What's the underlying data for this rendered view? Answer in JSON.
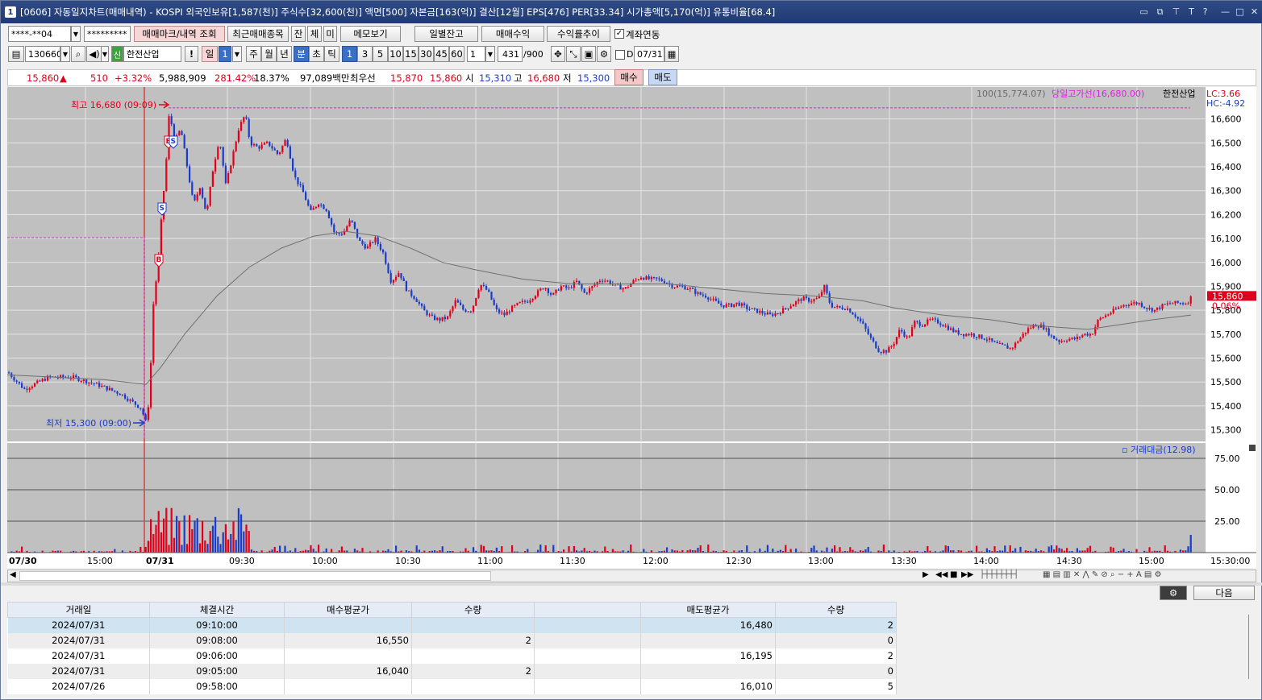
{
  "titlebar": {
    "num": "1",
    "text": "[0606] 자동일지차트(매매내역) - KOSPI 외국인보유[1,587(천)] 주식수[32,600(천)] 액면[500] 자본금[163(억)] 결산[12월] EPS[476] PER[33.34] 시가총액[5,170(억)] 유통비율[68.4]",
    "icons": [
      "window-layout-icon",
      "window-copy-icon",
      "pin-icon",
      "font-icon",
      "help-icon",
      "minimize-icon",
      "maximize-icon",
      "close-icon"
    ],
    "glyphs": [
      "▭",
      "⧉",
      "⊤",
      "T",
      "?",
      "—",
      "□",
      "✕"
    ]
  },
  "toolbar1": {
    "account": "****-**04",
    "password": "*********",
    "buttons": [
      "매매마크/내역 조회",
      "최근매매종목",
      "잔",
      "체",
      "미",
      "메모보기",
      "일별잔고",
      "매매수익",
      "수익률추이"
    ],
    "link_label": "계좌연동",
    "link_checked": true
  },
  "toolbar2": {
    "code": "130660",
    "credit": "신",
    "name": "한전산업",
    "warn": "!",
    "period_sel": "일",
    "period_num": "1",
    "periods": [
      "주",
      "월",
      "년"
    ],
    "intraday": [
      "분",
      "초",
      "틱"
    ],
    "intervals": [
      "1",
      "3",
      "5",
      "10",
      "15",
      "30",
      "45",
      "60"
    ],
    "step": "1",
    "count": "431",
    "max": "/900",
    "date": "07/31",
    "d_label": "D"
  },
  "quote": {
    "price": "15,860",
    "arrow": "▲",
    "change": "510",
    "pct": "+3.32%",
    "volume": "5,988,909",
    "vol_ratio": "281.42%",
    "turnover": "18.37%",
    "amount": "97,089백만",
    "best_label": "최우선",
    "ask": "15,870",
    "bid": "15,860",
    "open_label": "시",
    "open": "15,310",
    "high_label": "고",
    "high": "16,680",
    "low_label": "저",
    "low": "15,300",
    "buy": "매수",
    "sell": "매도"
  },
  "chart_data": {
    "type": "candlestick",
    "title": "",
    "y_ticks": [
      16600,
      16500,
      16400,
      16300,
      16200,
      16100,
      16000,
      15900,
      15800,
      15700,
      15600,
      15500,
      15400,
      15300
    ],
    "ylim": [
      15265,
      16700
    ],
    "x_labels": [
      "07/30",
      "15:00",
      "07/31",
      "09:30",
      "10:00",
      "10:30",
      "11:00",
      "11:30",
      "12:00",
      "12:30",
      "13:00",
      "13:30",
      "14:00",
      "14:30",
      "15:00",
      "15:30:00"
    ],
    "annotations": {
      "high": "최고 16,680 (09:09)",
      "low": "최저 15,300 (09:00)"
    },
    "legend": {
      "ma": "100(15,774.07)",
      "high_line": "당일고가선(16,680.00)",
      "series": "한전산업"
    },
    "prev_day_high": 16100,
    "today_high": 16680,
    "current": "15,860",
    "current_pct": "0.06%",
    "lc": "LC:3.66",
    "hc": "HC:-4.92",
    "marks": [
      "B",
      "S",
      "B",
      "S"
    ],
    "volume_panel": {
      "label": "거래대금(12.98)",
      "ticks": [
        "75.00",
        "50.00",
        "25.00"
      ]
    },
    "colors": {
      "up": "#e0001b",
      "down": "#1a3cc8",
      "ma": "#707070",
      "highline": "#e01ee0"
    }
  },
  "bottom": {
    "next": "다음",
    "icons": [
      "gear-icon"
    ]
  },
  "grid": {
    "headers": [
      "거래일",
      "체결시간",
      "매수평균가",
      "수량",
      "",
      "매도평균가",
      "수량"
    ],
    "rows": [
      [
        "2024/07/31",
        "09:10:00",
        "",
        "",
        "",
        "16,480",
        "2"
      ],
      [
        "2024/07/31",
        "09:08:00",
        "16,550",
        "2",
        "",
        "",
        "0"
      ],
      [
        "2024/07/31",
        "09:06:00",
        "",
        "",
        "",
        "16,195",
        "2"
      ],
      [
        "2024/07/31",
        "09:05:00",
        "16,040",
        "2",
        "",
        "",
        "0"
      ],
      [
        "2024/07/26",
        "09:58:00",
        "",
        "",
        "",
        "16,010",
        "5"
      ]
    ]
  }
}
